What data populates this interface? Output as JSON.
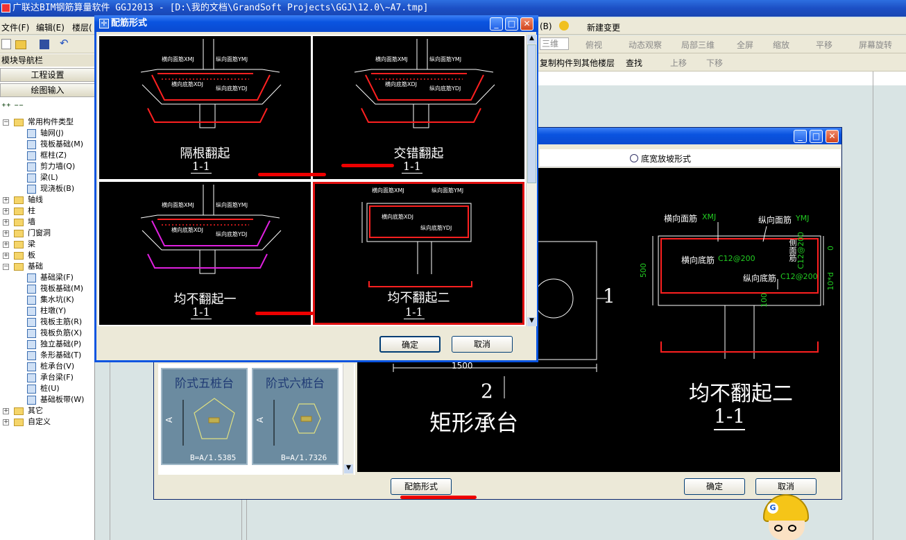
{
  "app": {
    "title": "广联达BIM钢筋算量软件 GGJ2013 - [D:\\我的文档\\GrandSoft Projects\\GGJ\\12.0\\~A7.tmp]"
  },
  "menubar": {
    "file": "文件(F)",
    "edit": "编辑(E)",
    "floor": "楼层(",
    "help": "(B)",
    "new_change": "新建变更"
  },
  "toolbar": {
    "view3d": "三维",
    "top_view": "俯视",
    "dynamic": "动态观察",
    "local3d": "局部三维",
    "fullscreen": "全屏",
    "zoom": "缩放",
    "pan": "平移",
    "rotate": "屏幕旋转",
    "copy_to_floor": "复制构件到其他楼层",
    "find": "查找",
    "up": "上移",
    "down": "下移"
  },
  "sidebar": {
    "title": "模块导航栏",
    "project_settings": "工程设置",
    "drawing_input": "绘图输入",
    "tree": [
      {
        "label": "常用构件类型",
        "level": 0,
        "expanded": true
      },
      {
        "label": "轴网(J)",
        "level": 1
      },
      {
        "label": "筏板基础(M)",
        "level": 1
      },
      {
        "label": "框柱(Z)",
        "level": 1
      },
      {
        "label": "剪力墙(Q)",
        "level": 1
      },
      {
        "label": "梁(L)",
        "level": 1
      },
      {
        "label": "现浇板(B)",
        "level": 1
      },
      {
        "label": "轴线",
        "level": 0
      },
      {
        "label": "柱",
        "level": 0
      },
      {
        "label": "墙",
        "level": 0
      },
      {
        "label": "门窗洞",
        "level": 0
      },
      {
        "label": "梁",
        "level": 0
      },
      {
        "label": "板",
        "level": 0
      },
      {
        "label": "基础",
        "level": 0,
        "expanded": true
      },
      {
        "label": "基础梁(F)",
        "level": 1
      },
      {
        "label": "筏板基础(M)",
        "level": 1
      },
      {
        "label": "集水坑(K)",
        "level": 1
      },
      {
        "label": "柱墩(Y)",
        "level": 1
      },
      {
        "label": "筏板主筋(R)",
        "level": 1
      },
      {
        "label": "筏板负筋(X)",
        "level": 1
      },
      {
        "label": "独立基础(P)",
        "level": 1
      },
      {
        "label": "条形基础(T)",
        "level": 1
      },
      {
        "label": "桩承台(V)",
        "level": 1
      },
      {
        "label": "承台梁(F)",
        "level": 1
      },
      {
        "label": "桩(U)",
        "level": 1
      },
      {
        "label": "基础板带(W)",
        "level": 1
      },
      {
        "label": "其它",
        "level": 0
      },
      {
        "label": "自定义",
        "level": 0
      }
    ]
  },
  "dialog_back": {
    "radio_label": "底宽放坡形式",
    "thumbs": [
      {
        "title": "阶式五桩台",
        "formula": "B=A/1.5385"
      },
      {
        "title": "阶式六桩台",
        "formula": "B=A/1.7326"
      }
    ],
    "thumb_a": "A",
    "dim_1500": "1500",
    "label_1": "1",
    "label_2": "2",
    "caption": "矩形承台",
    "detail_title": "均不翻起二",
    "detail_section": "1-1",
    "detail_texts": {
      "xmj": "横向面筋",
      "xmj_code": "XMJ",
      "ymj": "纵向面筋",
      "ymj_code": "YMJ",
      "xdj": "横向底筋",
      "xdj_val": "C12@200",
      "ydj": "纵向底筋",
      "ydj_val": "C12@200",
      "side": "侧面筋",
      "side_val": "C12@200",
      "dim_500": "500",
      "dim_100": "100",
      "dim_0": "0",
      "dim_10d": "10*d"
    },
    "rebar_btn": "配筋形式",
    "ok": "确定",
    "cancel": "取消"
  },
  "dialog_front": {
    "title": "配筋形式",
    "options": [
      {
        "title": "隔根翻起",
        "section": "1-1",
        "selected": false
      },
      {
        "title": "交错翻起",
        "section": "1-1",
        "selected": false
      },
      {
        "title": "均不翻起一",
        "section": "1-1",
        "selected": false
      },
      {
        "title": "均不翻起二",
        "section": "1-1",
        "selected": true
      }
    ],
    "mini": {
      "xmj": "横向面筋XMJ",
      "ymj": "纵向面筋YMJ",
      "xdj": "横向底筋XDJ",
      "ydj": "纵向底筋YDJ"
    },
    "ok": "确定",
    "cancel": "取消"
  },
  "colors": {
    "titlebar": "#1c4fc4",
    "cad_bg": "#000000",
    "rebar": "#ff2020",
    "green_text": "#22cc22",
    "magenta": "#e020e0",
    "selected_border": "#e01010"
  }
}
